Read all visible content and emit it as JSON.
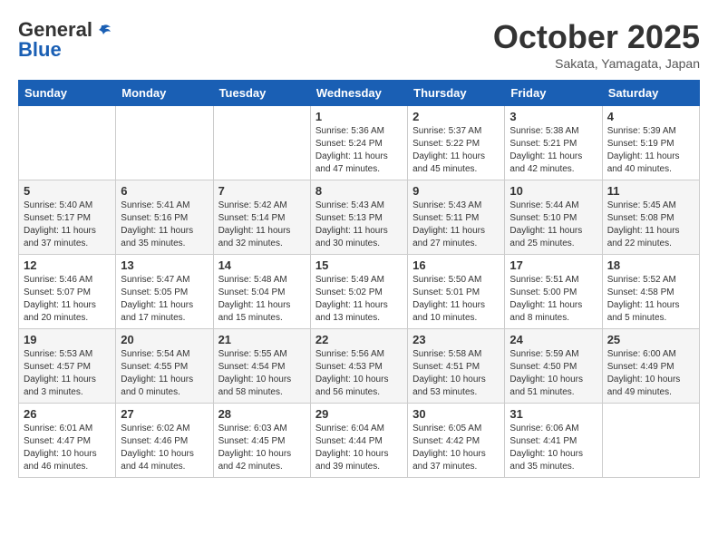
{
  "header": {
    "logo_general": "General",
    "logo_blue": "Blue",
    "month": "October 2025",
    "location": "Sakata, Yamagata, Japan"
  },
  "weekdays": [
    "Sunday",
    "Monday",
    "Tuesday",
    "Wednesday",
    "Thursday",
    "Friday",
    "Saturday"
  ],
  "weeks": [
    [
      {
        "day": "",
        "info": ""
      },
      {
        "day": "",
        "info": ""
      },
      {
        "day": "",
        "info": ""
      },
      {
        "day": "1",
        "info": "Sunrise: 5:36 AM\nSunset: 5:24 PM\nDaylight: 11 hours\nand 47 minutes."
      },
      {
        "day": "2",
        "info": "Sunrise: 5:37 AM\nSunset: 5:22 PM\nDaylight: 11 hours\nand 45 minutes."
      },
      {
        "day": "3",
        "info": "Sunrise: 5:38 AM\nSunset: 5:21 PM\nDaylight: 11 hours\nand 42 minutes."
      },
      {
        "day": "4",
        "info": "Sunrise: 5:39 AM\nSunset: 5:19 PM\nDaylight: 11 hours\nand 40 minutes."
      }
    ],
    [
      {
        "day": "5",
        "info": "Sunrise: 5:40 AM\nSunset: 5:17 PM\nDaylight: 11 hours\nand 37 minutes."
      },
      {
        "day": "6",
        "info": "Sunrise: 5:41 AM\nSunset: 5:16 PM\nDaylight: 11 hours\nand 35 minutes."
      },
      {
        "day": "7",
        "info": "Sunrise: 5:42 AM\nSunset: 5:14 PM\nDaylight: 11 hours\nand 32 minutes."
      },
      {
        "day": "8",
        "info": "Sunrise: 5:43 AM\nSunset: 5:13 PM\nDaylight: 11 hours\nand 30 minutes."
      },
      {
        "day": "9",
        "info": "Sunrise: 5:43 AM\nSunset: 5:11 PM\nDaylight: 11 hours\nand 27 minutes."
      },
      {
        "day": "10",
        "info": "Sunrise: 5:44 AM\nSunset: 5:10 PM\nDaylight: 11 hours\nand 25 minutes."
      },
      {
        "day": "11",
        "info": "Sunrise: 5:45 AM\nSunset: 5:08 PM\nDaylight: 11 hours\nand 22 minutes."
      }
    ],
    [
      {
        "day": "12",
        "info": "Sunrise: 5:46 AM\nSunset: 5:07 PM\nDaylight: 11 hours\nand 20 minutes."
      },
      {
        "day": "13",
        "info": "Sunrise: 5:47 AM\nSunset: 5:05 PM\nDaylight: 11 hours\nand 17 minutes."
      },
      {
        "day": "14",
        "info": "Sunrise: 5:48 AM\nSunset: 5:04 PM\nDaylight: 11 hours\nand 15 minutes."
      },
      {
        "day": "15",
        "info": "Sunrise: 5:49 AM\nSunset: 5:02 PM\nDaylight: 11 hours\nand 13 minutes."
      },
      {
        "day": "16",
        "info": "Sunrise: 5:50 AM\nSunset: 5:01 PM\nDaylight: 11 hours\nand 10 minutes."
      },
      {
        "day": "17",
        "info": "Sunrise: 5:51 AM\nSunset: 5:00 PM\nDaylight: 11 hours\nand 8 minutes."
      },
      {
        "day": "18",
        "info": "Sunrise: 5:52 AM\nSunset: 4:58 PM\nDaylight: 11 hours\nand 5 minutes."
      }
    ],
    [
      {
        "day": "19",
        "info": "Sunrise: 5:53 AM\nSunset: 4:57 PM\nDaylight: 11 hours\nand 3 minutes."
      },
      {
        "day": "20",
        "info": "Sunrise: 5:54 AM\nSunset: 4:55 PM\nDaylight: 11 hours\nand 0 minutes."
      },
      {
        "day": "21",
        "info": "Sunrise: 5:55 AM\nSunset: 4:54 PM\nDaylight: 10 hours\nand 58 minutes."
      },
      {
        "day": "22",
        "info": "Sunrise: 5:56 AM\nSunset: 4:53 PM\nDaylight: 10 hours\nand 56 minutes."
      },
      {
        "day": "23",
        "info": "Sunrise: 5:58 AM\nSunset: 4:51 PM\nDaylight: 10 hours\nand 53 minutes."
      },
      {
        "day": "24",
        "info": "Sunrise: 5:59 AM\nSunset: 4:50 PM\nDaylight: 10 hours\nand 51 minutes."
      },
      {
        "day": "25",
        "info": "Sunrise: 6:00 AM\nSunset: 4:49 PM\nDaylight: 10 hours\nand 49 minutes."
      }
    ],
    [
      {
        "day": "26",
        "info": "Sunrise: 6:01 AM\nSunset: 4:47 PM\nDaylight: 10 hours\nand 46 minutes."
      },
      {
        "day": "27",
        "info": "Sunrise: 6:02 AM\nSunset: 4:46 PM\nDaylight: 10 hours\nand 44 minutes."
      },
      {
        "day": "28",
        "info": "Sunrise: 6:03 AM\nSunset: 4:45 PM\nDaylight: 10 hours\nand 42 minutes."
      },
      {
        "day": "29",
        "info": "Sunrise: 6:04 AM\nSunset: 4:44 PM\nDaylight: 10 hours\nand 39 minutes."
      },
      {
        "day": "30",
        "info": "Sunrise: 6:05 AM\nSunset: 4:42 PM\nDaylight: 10 hours\nand 37 minutes."
      },
      {
        "day": "31",
        "info": "Sunrise: 6:06 AM\nSunset: 4:41 PM\nDaylight: 10 hours\nand 35 minutes."
      },
      {
        "day": "",
        "info": ""
      }
    ]
  ]
}
